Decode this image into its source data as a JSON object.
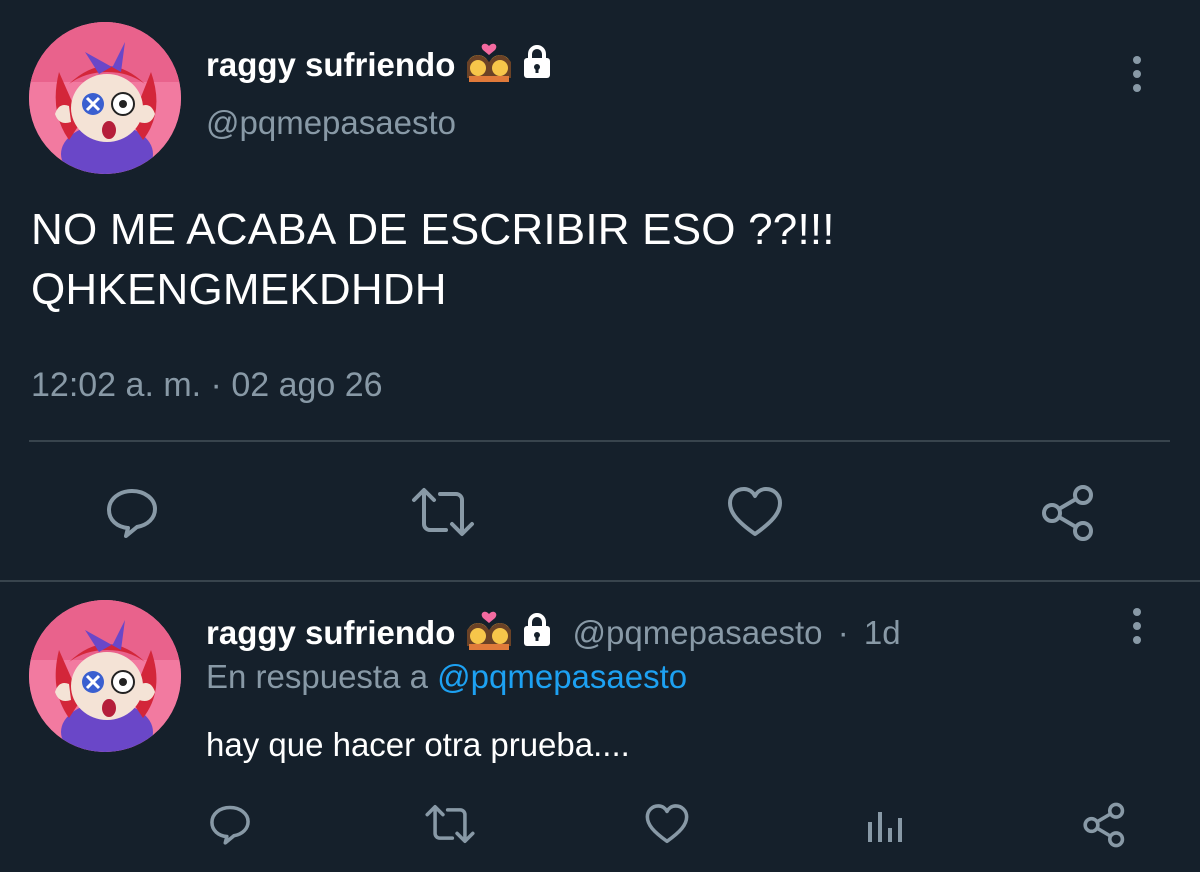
{
  "main_tweet": {
    "display_name": "raggy sufriendo",
    "name_emoji": "couple-kiss-emoji",
    "protected_icon": "lock-icon",
    "handle": "@pqmepasaesto",
    "text_line1": "NO ME ACABA DE ESCRIBIR ESO ??!!!",
    "text_line2": "QHKENGMEKDHDH",
    "timestamp": "12:02 a. m. · 02 ago 26",
    "actions": [
      "reply-icon",
      "retweet-icon",
      "like-icon",
      "share-icon"
    ]
  },
  "reply_tweet": {
    "display_name": "raggy sufriendo",
    "handle": "@pqmepasaesto",
    "separator": "·",
    "age": "1d",
    "reply_prefix": "En respuesta a",
    "reply_to_handle": "@pqmepasaesto",
    "text": "hay que hacer otra prueba....",
    "actions": [
      "reply-icon",
      "retweet-icon",
      "like-icon",
      "analytics-icon",
      "share-icon"
    ]
  },
  "colors": {
    "background": "#15202b",
    "muted": "#8899a6",
    "link": "#1da1f2",
    "divider": "#38444d"
  }
}
